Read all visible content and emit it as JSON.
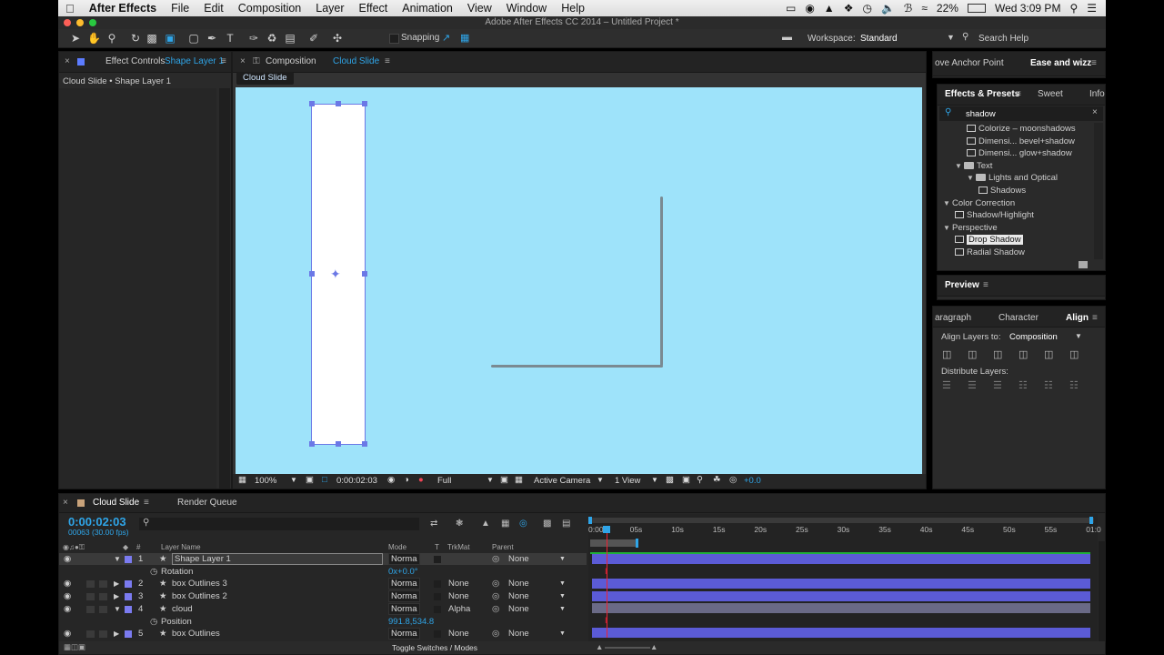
{
  "menubar": {
    "app": "After Effects",
    "items": [
      "File",
      "Edit",
      "Composition",
      "Layer",
      "Effect",
      "Animation",
      "View",
      "Window",
      "Help"
    ],
    "battery": "22%",
    "clock": "Wed 3:09 PM"
  },
  "window": {
    "title": "Adobe After Effects CC 2014 – Untitled Project *"
  },
  "toolbar": {
    "snapping_label": "Snapping",
    "workspace_label": "Workspace:",
    "workspace_value": "Standard",
    "search_placeholder": "Search Help"
  },
  "effect_controls": {
    "tab_prefix": "Effect Controls",
    "tab_layer": "Shape Layer 1",
    "subtitle": "Cloud Slide • Shape Layer 1"
  },
  "composition": {
    "tab_prefix": "Composition",
    "tab_name": "Cloud Slide",
    "subtab": "Cloud Slide",
    "canvas_color": "#9ee3fa",
    "zoom": "100%",
    "timecode": "0:00:02:03",
    "resolution": "Full",
    "camera": "Active Camera",
    "views": "1 View",
    "exposure": "+0.0"
  },
  "right_top": {
    "tab1": "ove Anchor Point",
    "tab2": "Ease and wizz"
  },
  "effects_presets": {
    "tab1": "Effects & Presets",
    "tab2": "Sweet",
    "tab3": "Info",
    "search_value": "shadow",
    "items": [
      {
        "label": "Colorize – moonshadows",
        "kind": "preset",
        "indent": 2
      },
      {
        "label": "Dimensi... bevel+shadow",
        "kind": "preset",
        "indent": 2
      },
      {
        "label": "Dimensi... glow+shadow",
        "kind": "preset",
        "indent": 2
      },
      {
        "label": "Text",
        "kind": "folder",
        "indent": 1
      },
      {
        "label": "Lights and Optical",
        "kind": "folder",
        "indent": 2
      },
      {
        "label": "Shadows",
        "kind": "preset",
        "indent": 3
      },
      {
        "label": "Color Correction",
        "kind": "category",
        "indent": 0
      },
      {
        "label": "Shadow/Highlight",
        "kind": "effect",
        "indent": 1
      },
      {
        "label": "Perspective",
        "kind": "category",
        "indent": 0
      },
      {
        "label": "Drop Shadow",
        "kind": "effect",
        "indent": 1,
        "selected": true
      },
      {
        "label": "Radial Shadow",
        "kind": "effect",
        "indent": 1
      }
    ]
  },
  "preview": {
    "tab": "Preview"
  },
  "align": {
    "tab1": "aragraph",
    "tab2": "Character",
    "tab3": "Align",
    "align_to_label": "Align Layers to:",
    "align_to_value": "Composition",
    "distribute_label": "Distribute Layers:"
  },
  "timeline": {
    "tab": "Cloud Slide",
    "render_queue": "Render Queue",
    "timecode": "0:00:02:03",
    "frames": "00063 (30.00 fps)",
    "headers": {
      "layer_name": "Layer Name",
      "mode": "Mode",
      "t": "T",
      "trkmat": "TrkMat",
      "parent": "Parent"
    },
    "ruler": [
      "0:00s",
      "05s",
      "10s",
      "15s",
      "20s",
      "25s",
      "30s",
      "35s",
      "40s",
      "45s",
      "50s",
      "55s",
      "01:0"
    ],
    "rows": [
      {
        "num": "1",
        "name": "Shape Layer 1",
        "mode": "Norma",
        "trkmat": "",
        "parent": "None",
        "color": "#7b7bf0",
        "expanded": true,
        "selected": true
      },
      {
        "prop": "Rotation",
        "value": "0x+0.0°"
      },
      {
        "num": "2",
        "name": "box Outlines 3",
        "mode": "Norma",
        "trkmat": "None",
        "parent": "None",
        "color": "#7b7bf0"
      },
      {
        "num": "3",
        "name": "box Outlines 2",
        "mode": "Norma",
        "trkmat": "None",
        "parent": "None",
        "color": "#7b7bf0"
      },
      {
        "num": "4",
        "name": "cloud",
        "mode": "Norma",
        "trkmat": "Alpha",
        "parent": "None",
        "color": "#7b7bf0",
        "expanded": true
      },
      {
        "prop": "Position",
        "value": "991.8,534.8"
      },
      {
        "num": "5",
        "name": "box Outlines",
        "mode": "Norma",
        "trkmat": "None",
        "parent": "None",
        "color": "#7b7bf0"
      }
    ],
    "toggle_label": "Toggle Switches / Modes"
  }
}
